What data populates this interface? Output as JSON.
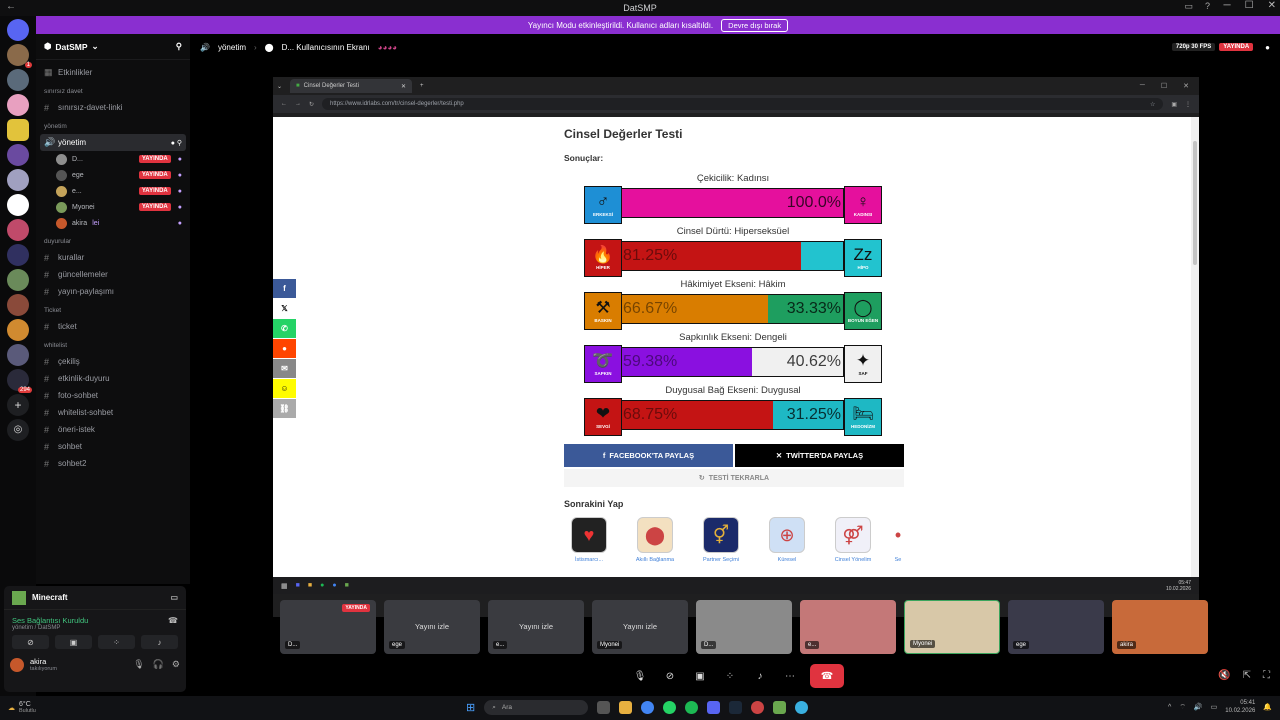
{
  "app": {
    "title": "DatSMP"
  },
  "banner": {
    "text": "Yayıncı Modu etkinleştirildi. Kullanıcı adları kısaltıldı.",
    "button": "Devre dışı bırak"
  },
  "guild": {
    "name": "DatSMP"
  },
  "sidebar": {
    "events": "Etkinlikler",
    "cat_invite": "sınırsız davet",
    "invite_channel": "sınırsız-davet-linki",
    "cat_admin": "yönetim",
    "voice_channel": "yönetim",
    "voice_users": [
      {
        "name": "D...",
        "live": "YAYINDA",
        "color": "#8e8e8e"
      },
      {
        "name": "ege",
        "live": "YAYINDA",
        "color": "#555"
      },
      {
        "name": "e...",
        "live": "YAYINDA",
        "color": "#c4a35a"
      },
      {
        "name": "Myonei",
        "live": "YAYINDA",
        "color": "#7a9a5a"
      },
      {
        "name": "akira",
        "live": "",
        "tag": "lei",
        "color": "#c6582b"
      }
    ],
    "cat_announce": "duyurular",
    "announce_channels": [
      "kurallar",
      "güncellemeler",
      "yayın-paylaşımı"
    ],
    "cat_ticket": "Ticket",
    "ticket_channel": "ticket",
    "cat_whitelist": "whitelist",
    "whitelist_channels": [
      "çekiliş",
      "etkinlik-duyuru",
      "foto-sohbet",
      "whitelist-sohbet",
      "öneri-istek",
      "sohbet",
      "sohbet2"
    ]
  },
  "userpanel": {
    "game": "Minecraft",
    "conn_status": "Ses Bağlantısı Kuruldu",
    "conn_sub": "yönetim / DatSMP",
    "username": "akira",
    "status": "takılıyorum"
  },
  "stage": {
    "channel": "yönetim",
    "screen_title": "D... Kullanıcısının Ekranı",
    "quality": "720p 30 FPS",
    "live": "YAYINDA"
  },
  "browser": {
    "tab_title": "Cinsel Değerler Testi",
    "url": "https://www.idrlabs.com/tr/cinsel-degerler/testi.php"
  },
  "page": {
    "title": "Cinsel Değerler Testi",
    "results_label": "Sonuçlar:",
    "results": [
      {
        "title": "Çekicilik: Kadınsı",
        "left_pct": 0,
        "left_label": "",
        "right_label": "100.0%",
        "left_color": "#e5109d",
        "right_color": "#e5109d",
        "left_icon": "ERKEKSİ",
        "right_icon": "KADINSI",
        "left_icon_color": "#1e8fd5",
        "right_icon_color": "#e5109d",
        "left_glyph": "♂",
        "right_glyph": "♀",
        "left_icon_name": "male-icon",
        "right_icon_name": "female-icon"
      },
      {
        "title": "Cinsel Dürtü: Hiperseksüel",
        "left_pct": 81.25,
        "left_label": "81.25%",
        "right_label": "",
        "left_color": "#c41414",
        "right_color": "#22c3cf",
        "left_icon": "HİPER",
        "right_icon": "HİPO",
        "left_icon_color": "#c41414",
        "right_icon_color": "#22c3cf",
        "left_glyph": "🔥",
        "right_glyph": "Zz",
        "left_icon_name": "fire-icon",
        "right_icon_name": "sleep-icon"
      },
      {
        "title": "Hâkimiyet Ekseni: Hâkim",
        "left_pct": 66.67,
        "left_label": "66.67%",
        "right_label": "33.33%",
        "left_color": "#d97d00",
        "right_color": "#1e9e5f",
        "left_icon": "BASKIN",
        "right_icon": "BOYUN EĞEN",
        "left_icon_color": "#d97d00",
        "right_icon_color": "#1e9e5f",
        "left_glyph": "⚒",
        "right_glyph": "◯",
        "left_icon_name": "hammer-icon",
        "right_icon_name": "collar-icon"
      },
      {
        "title": "Sapkınlık Ekseni: Dengeli",
        "left_pct": 59.38,
        "left_label": "59.38%",
        "right_label": "40.62%",
        "left_color": "#8a10e0",
        "right_color": "#f0f0f0",
        "left_icon": "SAPKIN",
        "right_icon": "SAF",
        "left_icon_color": "#8a10e0",
        "right_icon_color": "#f0f0f0",
        "left_glyph": "➰",
        "right_glyph": "✦",
        "left_icon_name": "rope-icon",
        "right_icon_name": "sparkle-icon"
      },
      {
        "title": "Duygusal Bağ Ekseni: Duygusal",
        "left_pct": 68.75,
        "left_label": "68.75%",
        "right_label": "31.25%",
        "left_color": "#c41414",
        "right_color": "#1eb8c4",
        "left_icon": "SEVGİ",
        "right_icon": "HEDONİZM",
        "left_icon_color": "#c41414",
        "right_icon_color": "#1eb8c4",
        "left_glyph": "❤",
        "right_glyph": "🛏",
        "left_icon_name": "hearts-icon",
        "right_icon_name": "bed-icon"
      }
    ],
    "share_fb": "FACEBOOK'TA PAYLAŞ",
    "share_tw": "TWİTTER'DA PAYLAŞ",
    "retry": "TESTİ TEKRARLA",
    "next_title": "Sonrakini Yap",
    "next_tests": [
      "İstismarcı...",
      "Akıllı Bağlanma",
      "Partner Seçimi",
      "Küresel",
      "Cinsel Yönelim",
      "Se"
    ]
  },
  "inner_taskbar": {
    "time": "05:47",
    "date": "10.02.2026"
  },
  "thumbnails": [
    {
      "label": "D...",
      "live": "YAYINDA",
      "mid": ""
    },
    {
      "label": "ege",
      "live": "",
      "mid": "Yayını izle"
    },
    {
      "label": "e...",
      "live": "",
      "mid": "Yayını izle"
    },
    {
      "label": "Myonei",
      "live": "",
      "mid": "Yayını izle"
    },
    {
      "label": "D...",
      "live": "",
      "mid": ""
    },
    {
      "label": "e...",
      "live": "",
      "mid": ""
    },
    {
      "label": "Myonei",
      "live": "",
      "mid": ""
    },
    {
      "label": "ege",
      "live": "",
      "mid": ""
    },
    {
      "label": "akira",
      "live": "",
      "mid": ""
    }
  ],
  "taskbar": {
    "temp": "6°C",
    "weather": "Bulutlu",
    "search_placeholder": "Ara",
    "time": "05:41",
    "date": "10.02.2026"
  }
}
